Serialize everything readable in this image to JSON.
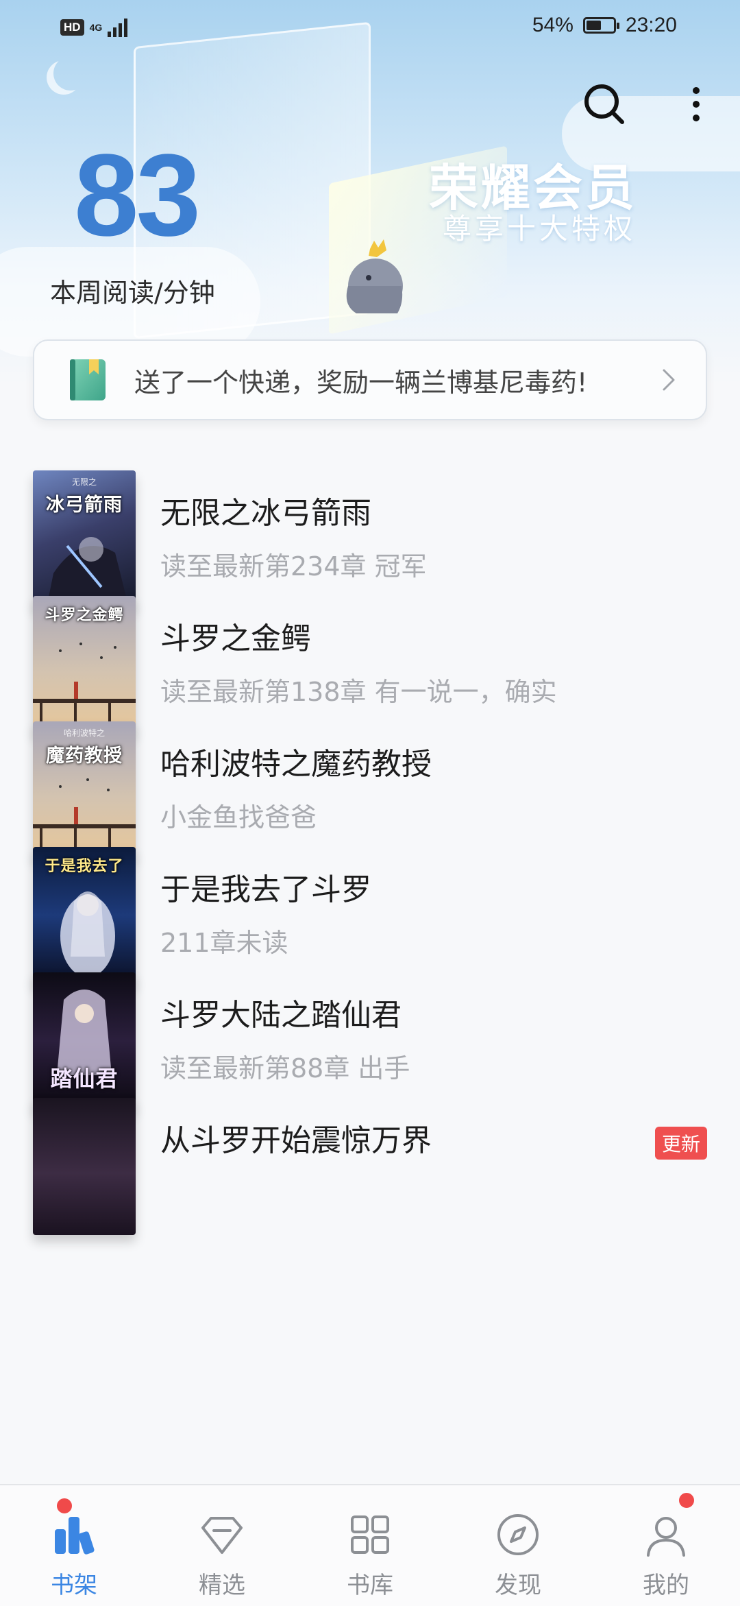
{
  "status_bar": {
    "hd": "HD",
    "network": "4G",
    "battery_percent": "54%",
    "battery_level": 0.54,
    "time": "23:20"
  },
  "header": {
    "reading_minutes": "83",
    "reading_label": "本周阅读/分钟",
    "vip_title": "荣耀会员",
    "vip_subtitle": "尊享十大特权"
  },
  "notice": {
    "text": "送了一个快递，奖励一辆兰博基尼毒药!"
  },
  "books": [
    {
      "title": "无限之冰弓箭雨",
      "progress": "读至最新第234章 冠军",
      "cover_series": "无限之",
      "cover_title": "冰弓箭雨",
      "badge": ""
    },
    {
      "title": "斗罗之金鳄",
      "progress": "读至最新第138章 有一说一，确实",
      "cover_series": "",
      "cover_title": "斗罗之金鳄",
      "badge": ""
    },
    {
      "title": "哈利波特之魔药教授",
      "progress": "小金鱼找爸爸",
      "cover_series": "哈利波特之",
      "cover_title": "魔药教授",
      "badge": ""
    },
    {
      "title": "于是我去了斗罗",
      "progress": "211章未读",
      "cover_series": "",
      "cover_title": "于是我去了",
      "badge": ""
    },
    {
      "title": "斗罗大陆之踏仙君",
      "progress": "读至最新第88章 出手",
      "cover_series": "",
      "cover_title": "踏仙君",
      "badge": ""
    },
    {
      "title": "从斗罗开始震惊万界",
      "progress": "",
      "cover_series": "",
      "cover_title": "",
      "badge": "更新"
    }
  ],
  "bottom_nav": [
    {
      "label": "书架",
      "icon": "bookshelf-icon",
      "active": true,
      "dot": true
    },
    {
      "label": "精选",
      "icon": "diamond-icon",
      "active": false,
      "dot": false
    },
    {
      "label": "书库",
      "icon": "grid-icon",
      "active": false,
      "dot": false
    },
    {
      "label": "发现",
      "icon": "compass-icon",
      "active": false,
      "dot": false
    },
    {
      "label": "我的",
      "icon": "user-icon",
      "active": false,
      "dot": true
    }
  ],
  "colors": {
    "accent": "#3b86e3",
    "stat_number": "#3d7fd1",
    "badge_red": "#ef4f4f",
    "subtext": "#a9abb0"
  }
}
